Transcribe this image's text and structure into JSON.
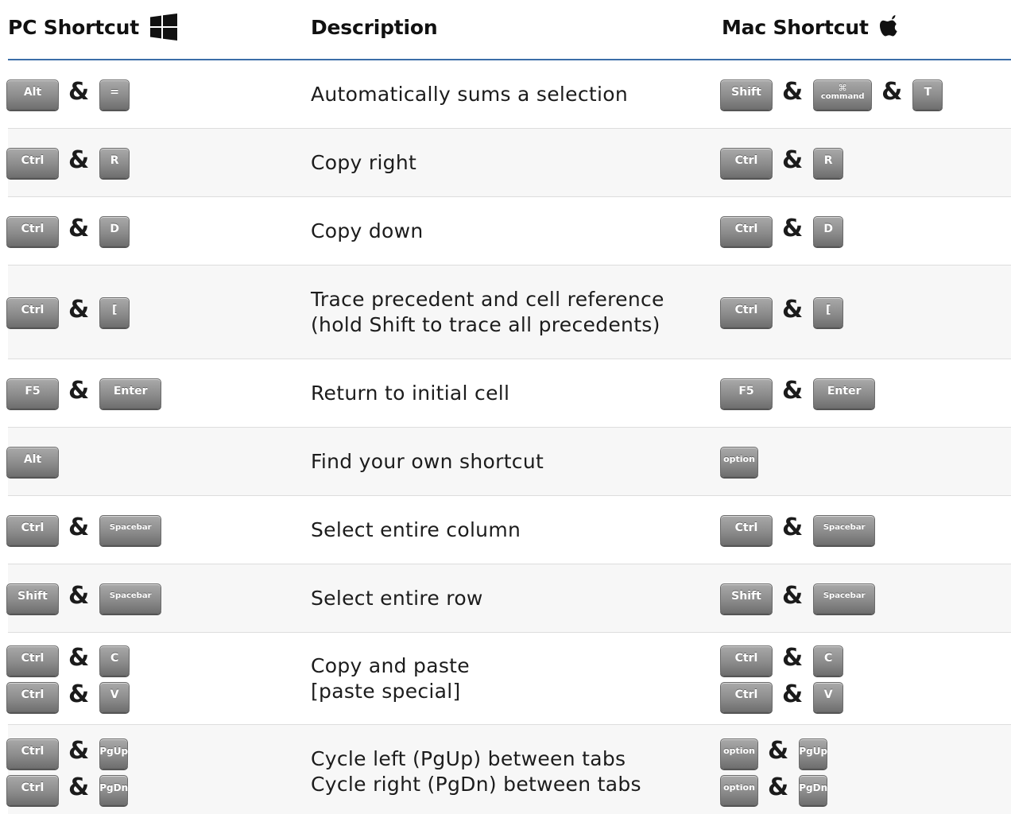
{
  "header": {
    "pc_label": "PC Shortcut",
    "desc_label": "Description",
    "mac_label": "Mac Shortcut",
    "pc_icon": "windows-logo-icon",
    "mac_icon": "apple-logo-icon"
  },
  "separator": "&",
  "colors": {
    "header_rule": "#3b6ea8",
    "alt_row": "#f7f7f7",
    "key_face": "#8c8c8c",
    "key_text": "#ffffff"
  },
  "rows": [
    {
      "desc": [
        "Automatically sums a selection"
      ],
      "pc": [
        [
          "Alt",
          "="
        ]
      ],
      "mac": [
        [
          "Shift",
          "command",
          "T"
        ]
      ],
      "mac_command_symbol": "⌘"
    },
    {
      "desc": [
        "Copy right"
      ],
      "pc": [
        [
          "Ctrl",
          "R"
        ]
      ],
      "mac": [
        [
          "Ctrl",
          "R"
        ]
      ]
    },
    {
      "desc": [
        "Copy down"
      ],
      "pc": [
        [
          "Ctrl",
          "D"
        ]
      ],
      "mac": [
        [
          "Ctrl",
          "D"
        ]
      ]
    },
    {
      "desc": [
        "Trace precedent and cell reference",
        "(hold Shift to trace all precedents)"
      ],
      "pc": [
        [
          "Ctrl",
          "["
        ]
      ],
      "mac": [
        [
          "Ctrl",
          "["
        ]
      ]
    },
    {
      "desc": [
        "Return to initial cell"
      ],
      "pc": [
        [
          "F5",
          "Enter"
        ]
      ],
      "mac": [
        [
          "F5",
          "Enter"
        ]
      ]
    },
    {
      "desc": [
        "Find your own shortcut"
      ],
      "pc": [
        [
          "Alt"
        ]
      ],
      "mac": [
        [
          "option"
        ]
      ]
    },
    {
      "desc": [
        "Select entire column"
      ],
      "pc": [
        [
          "Ctrl",
          "Spacebar"
        ]
      ],
      "mac": [
        [
          "Ctrl",
          "Spacebar"
        ]
      ]
    },
    {
      "desc": [
        "Select entire row"
      ],
      "pc": [
        [
          "Shift",
          "Spacebar"
        ]
      ],
      "mac": [
        [
          "Shift",
          "Spacebar"
        ]
      ]
    },
    {
      "desc": [
        "Copy and paste",
        "[paste special]"
      ],
      "pc": [
        [
          "Ctrl",
          "C"
        ],
        [
          "Ctrl",
          "V"
        ]
      ],
      "mac": [
        [
          "Ctrl",
          "C"
        ],
        [
          "Ctrl",
          "V"
        ]
      ]
    },
    {
      "desc": [
        "Cycle left (PgUp) between tabs",
        "Cycle right (PgDn) between tabs"
      ],
      "pc": [
        [
          "Ctrl",
          "PgUp"
        ],
        [
          "Ctrl",
          "PgDn"
        ]
      ],
      "mac": [
        [
          "option",
          "PgUp"
        ],
        [
          "option",
          "PgDn"
        ]
      ]
    }
  ]
}
